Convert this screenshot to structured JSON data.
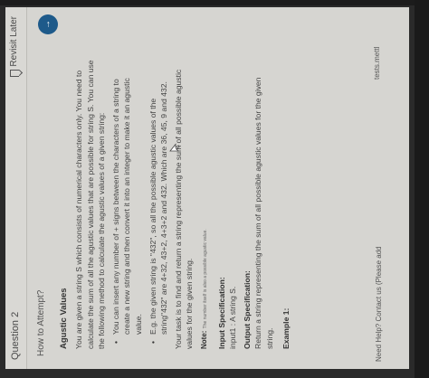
{
  "header": {
    "question_label": "Question 2",
    "revisit_label": "Revisit Later"
  },
  "how_to_attempt": "How to Attempt?",
  "problem": {
    "title": "Agustic Values",
    "description": "You are given a string S which consists of numerical characters only. You need to calculate the sum of all the agustic values that are possible for string S. You can use the following method to calculate the agustic values of a given string:",
    "bullets": [
      "You can insert any number of + signs between the characters of a string to create a new string and then convert it into an integer to make it an agustic value.",
      "E.g. the given string is \"432\", so all the possible agustic values of the string\"432\" are 4+32, 43+2, 4+3+2 and 432. Which are 36, 45, 9 and 432."
    ],
    "task": "Your task is to find and return a string representing the sum of all possible agustic values for the given string.",
    "note_label": "Note:",
    "note_text": "The number itself is also a possible agustic value.",
    "input_spec_title": "Input Specification:",
    "input_spec_text": "input1 : A string S.",
    "output_spec_title": "Output Specification:",
    "output_spec_text": "Return a string representing the sum of all possible agustic values for the given string.",
    "example_title": "Example 1:"
  },
  "footer": {
    "help_text": "Need Help? Contact us (Please add",
    "side_text": "tests.mettl"
  },
  "icons": {
    "scroll_button": "arrow-icon",
    "bookmark": "bookmark-icon",
    "cursor": "cursor-icon",
    "wifi": "wifi-icon"
  },
  "colors": {
    "accent": "#1e5a8a",
    "page_bg": "#d6d5d1"
  }
}
